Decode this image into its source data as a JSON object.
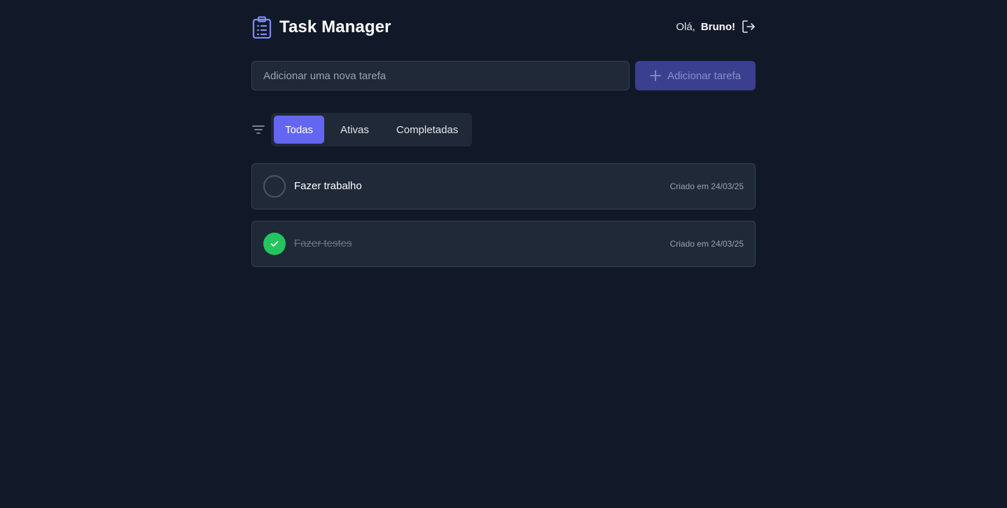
{
  "app": {
    "title": "Task Manager",
    "accent_color": "#6366f1",
    "brand_icon": "clipboard-list-icon"
  },
  "user": {
    "greeting": "Olá,",
    "name": "Bruno!",
    "logout_icon": "logout-icon"
  },
  "new_task": {
    "value": "",
    "placeholder": "Adicionar uma nova tarefa",
    "button_label": "Adicionar tarefa",
    "button_icon": "plus-icon"
  },
  "filters": {
    "icon": "filter-icon",
    "tabs": [
      {
        "label": "Todas",
        "active": true
      },
      {
        "label": "Ativas",
        "active": false
      },
      {
        "label": "Completadas",
        "active": false
      }
    ]
  },
  "tasks": [
    {
      "title": "Fazer trabalho",
      "created": "Criado em 24/03/25",
      "completed": false
    },
    {
      "title": "Fazer testes",
      "created": "Criado em 24/03/25",
      "completed": true,
      "check_color": "#22c55e"
    }
  ]
}
